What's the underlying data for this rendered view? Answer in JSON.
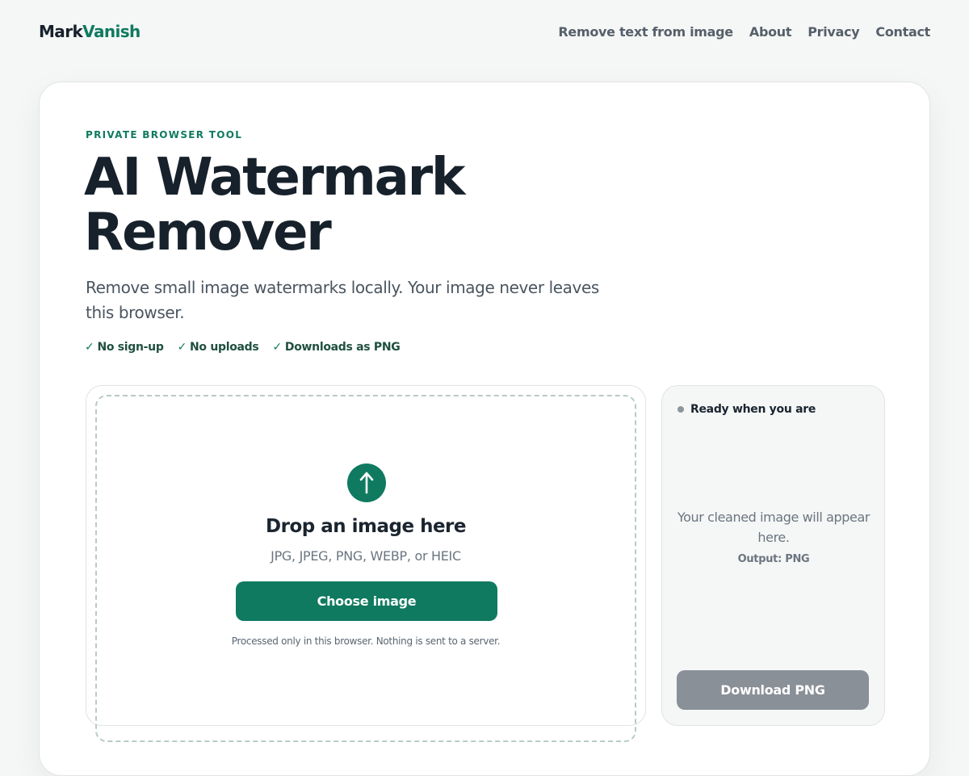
{
  "header": {
    "logo_part1": "Mark",
    "logo_part2": "Vanish",
    "nav": [
      {
        "label": "Remove text from image"
      },
      {
        "label": "About"
      },
      {
        "label": "Privacy"
      },
      {
        "label": "Contact"
      }
    ]
  },
  "hero": {
    "eyebrow": "PRIVATE BROWSER TOOL",
    "title_line1": "AI Watermark",
    "title_line2": "Remover",
    "subtitle": "Remove small image watermarks locally. Your image never leaves this browser.",
    "checks": [
      {
        "tick": "✓",
        "label": "No sign-up"
      },
      {
        "tick": "✓",
        "label": "No uploads"
      },
      {
        "tick": "✓",
        "label": "Downloads as PNG"
      }
    ]
  },
  "upload": {
    "icon": "upload-arrow-icon",
    "title": "Drop an image here",
    "formats": "JPG, JPEG, PNG, WEBP, or HEIC",
    "button_label": "Choose image",
    "note": "Processed only in this browser. Nothing is sent to a server."
  },
  "result": {
    "status": "Ready when you are",
    "message": "Your cleaned image will appear here.",
    "output": "Output: PNG",
    "download_label": "Download PNG"
  },
  "colors": {
    "accent": "#0f7a60",
    "text": "#17212b",
    "muted": "#6b7580",
    "disabled_button": "#8a9097",
    "page_bg": "#f5f7f6"
  }
}
